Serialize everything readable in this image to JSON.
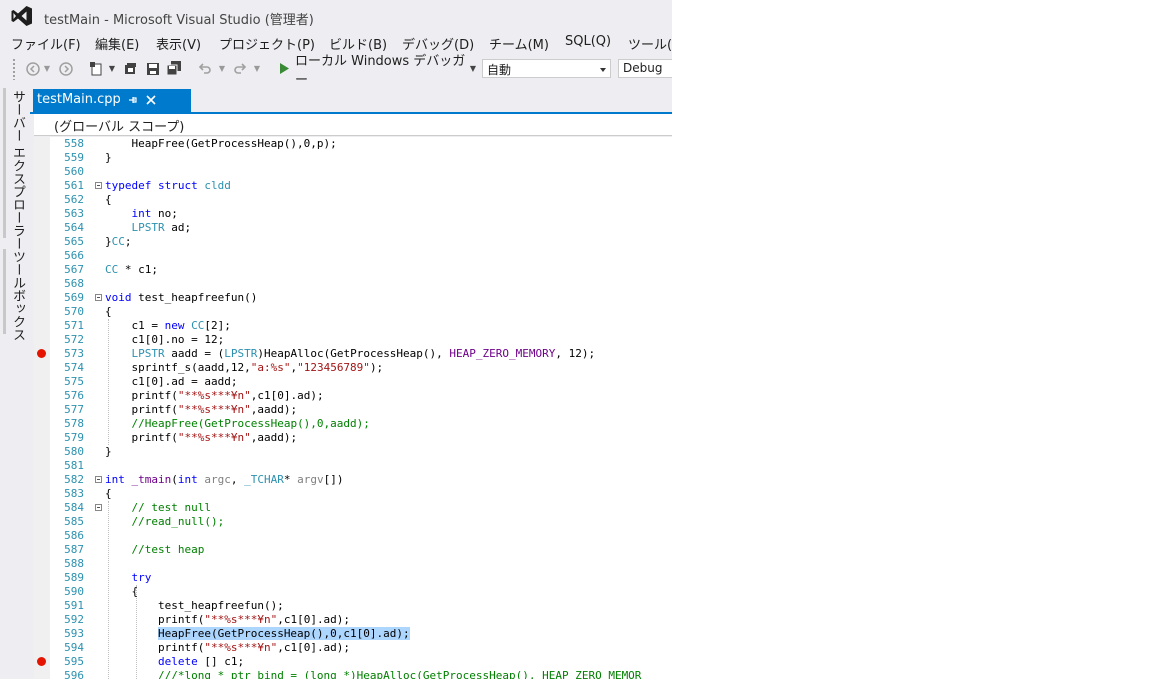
{
  "window": {
    "title": "testMain - Microsoft Visual Studio (管理者)"
  },
  "menu": [
    "ファイル(F)",
    "編集(E)",
    "表示(V)",
    "プロジェクト(P)",
    "ビルド(B)",
    "デバッグ(D)",
    "チーム(M)",
    "SQL(Q)",
    "ツール(T)"
  ],
  "toolbar": {
    "run_label": "ローカル Windows デバッガー",
    "config_value": "自動",
    "build_config_value": "Debug",
    "icons": [
      "back-icon",
      "forward-icon",
      "new-project-icon",
      "open-file-icon",
      "save-icon",
      "save-all-icon",
      "undo-icon",
      "redo-icon",
      "start-debugging-icon"
    ]
  },
  "side_tabs": [
    "サーバー エクスプローラー",
    "ツールボックス"
  ],
  "tab": {
    "filename": "testMain.cpp"
  },
  "scope": "(グローバル スコープ)",
  "colors": {
    "accent": "#007acc",
    "keyword": "#0000ff",
    "type": "#2b91af",
    "comment": "#008000",
    "string": "#a31515",
    "macro": "#6f008a",
    "breakpoint": "#e51400",
    "selection": "#add6ff"
  },
  "code_lines": [
    {
      "n": "558",
      "segs": [
        [
          "",
          "    HeapFree(GetProcessHeap(),0,p);"
        ]
      ]
    },
    {
      "n": "559",
      "segs": [
        [
          "",
          "}"
        ]
      ]
    },
    {
      "n": "560",
      "segs": []
    },
    {
      "n": "561",
      "fold": true,
      "segs": [
        [
          "k",
          "typedef"
        ],
        [
          "",
          " "
        ],
        [
          "k",
          "struct"
        ],
        [
          "",
          " "
        ],
        [
          "t",
          "cldd"
        ]
      ]
    },
    {
      "n": "562",
      "segs": [
        [
          "",
          "{"
        ]
      ]
    },
    {
      "n": "563",
      "segs": [
        [
          "",
          "    "
        ],
        [
          "k",
          "int"
        ],
        [
          "",
          " no;"
        ]
      ]
    },
    {
      "n": "564",
      "segs": [
        [
          "",
          "    "
        ],
        [
          "t",
          "LPSTR"
        ],
        [
          "",
          " ad;"
        ]
      ]
    },
    {
      "n": "565",
      "segs": [
        [
          "",
          "}"
        ],
        [
          "t",
          "CC"
        ],
        [
          "",
          ";"
        ]
      ]
    },
    {
      "n": "566",
      "segs": []
    },
    {
      "n": "567",
      "segs": [
        [
          "t",
          "CC"
        ],
        [
          "",
          " * c1;"
        ]
      ]
    },
    {
      "n": "568",
      "segs": []
    },
    {
      "n": "569",
      "fold": true,
      "segs": [
        [
          "k",
          "void"
        ],
        [
          "",
          " test_heapfreefun()"
        ]
      ]
    },
    {
      "n": "570",
      "segs": [
        [
          "",
          "{"
        ]
      ]
    },
    {
      "n": "571",
      "segs": [
        [
          "",
          "    c1 = "
        ],
        [
          "k",
          "new"
        ],
        [
          "",
          " "
        ],
        [
          "t",
          "CC"
        ],
        [
          "",
          "[2];"
        ]
      ]
    },
    {
      "n": "572",
      "segs": [
        [
          "",
          "    c1[0].no = 12;"
        ]
      ]
    },
    {
      "n": "573",
      "bp": true,
      "segs": [
        [
          "",
          "    "
        ],
        [
          "t",
          "LPSTR"
        ],
        [
          "",
          " aadd = ("
        ],
        [
          "t",
          "LPSTR"
        ],
        [
          "",
          ")HeapAlloc(GetProcessHeap(), "
        ],
        [
          "m",
          "HEAP_ZERO_MEMORY"
        ],
        [
          "",
          ", 12);"
        ]
      ]
    },
    {
      "n": "574",
      "segs": [
        [
          "",
          "    sprintf_s(aadd,12,"
        ],
        [
          "s",
          "\"a:%s\""
        ],
        [
          "",
          ","
        ],
        [
          "s",
          "\"123456789\""
        ],
        [
          "",
          ");"
        ]
      ]
    },
    {
      "n": "575",
      "segs": [
        [
          "",
          "    c1[0].ad = aadd;"
        ]
      ]
    },
    {
      "n": "576",
      "segs": [
        [
          "",
          "    printf("
        ],
        [
          "s",
          "\"**%s***¥n\""
        ],
        [
          "",
          ",c1[0].ad);"
        ]
      ]
    },
    {
      "n": "577",
      "segs": [
        [
          "",
          "    printf("
        ],
        [
          "s",
          "\"**%s***¥n\""
        ],
        [
          "",
          ",aadd);"
        ]
      ]
    },
    {
      "n": "578",
      "segs": [
        [
          "",
          "    "
        ],
        [
          "c",
          "//HeapFree(GetProcessHeap(),0,aadd);"
        ]
      ]
    },
    {
      "n": "579",
      "segs": [
        [
          "",
          "    printf("
        ],
        [
          "s",
          "\"**%s***¥n\""
        ],
        [
          "",
          ",aadd);"
        ]
      ]
    },
    {
      "n": "580",
      "segs": [
        [
          "",
          "}"
        ]
      ]
    },
    {
      "n": "581",
      "segs": []
    },
    {
      "n": "582",
      "fold": true,
      "segs": [
        [
          "k",
          "int"
        ],
        [
          "",
          " "
        ],
        [
          "m",
          "_tmain"
        ],
        [
          "",
          "("
        ],
        [
          "k",
          "int"
        ],
        [
          "",
          " "
        ],
        [
          "p",
          "argc"
        ],
        [
          "",
          ", "
        ],
        [
          "t",
          "_TCHAR"
        ],
        [
          "",
          "* "
        ],
        [
          "p",
          "argv"
        ],
        [
          "",
          "[])"
        ]
      ]
    },
    {
      "n": "583",
      "segs": [
        [
          "",
          "{"
        ]
      ]
    },
    {
      "n": "584",
      "fold": true,
      "segs": [
        [
          "",
          "    "
        ],
        [
          "c",
          "// test null"
        ]
      ]
    },
    {
      "n": "585",
      "segs": [
        [
          "",
          "    "
        ],
        [
          "c",
          "//read_null();"
        ]
      ]
    },
    {
      "n": "586",
      "segs": []
    },
    {
      "n": "587",
      "segs": [
        [
          "",
          "    "
        ],
        [
          "c",
          "//test heap"
        ]
      ]
    },
    {
      "n": "588",
      "segs": []
    },
    {
      "n": "589",
      "segs": [
        [
          "",
          "    "
        ],
        [
          "k",
          "try"
        ]
      ]
    },
    {
      "n": "590",
      "segs": [
        [
          "",
          "    {"
        ]
      ]
    },
    {
      "n": "591",
      "segs": [
        [
          "",
          "        test_heapfreefun();"
        ]
      ]
    },
    {
      "n": "592",
      "segs": [
        [
          "",
          "        printf("
        ],
        [
          "s",
          "\"**%s***¥n\""
        ],
        [
          "",
          ",c1[0].ad);"
        ]
      ]
    },
    {
      "n": "593",
      "segs": [
        [
          "",
          "        "
        ],
        [
          "sel",
          "HeapFree(GetProcessHeap(),0,c1[0].ad);"
        ]
      ]
    },
    {
      "n": "594",
      "segs": [
        [
          "",
          "        printf("
        ],
        [
          "s",
          "\"**%s***¥n\""
        ],
        [
          "",
          ",c1[0].ad);"
        ]
      ]
    },
    {
      "n": "595",
      "bp": true,
      "segs": [
        [
          "",
          "        "
        ],
        [
          "k",
          "delete"
        ],
        [
          "",
          " [] c1;"
        ]
      ]
    },
    {
      "n": "596",
      "segs": [
        [
          "",
          "        "
        ],
        [
          "c",
          "///*long * ptr_bind = (long *)HeapAlloc(GetProcessHeap(), HEAP_ZERO_MEMOR"
        ]
      ]
    }
  ]
}
